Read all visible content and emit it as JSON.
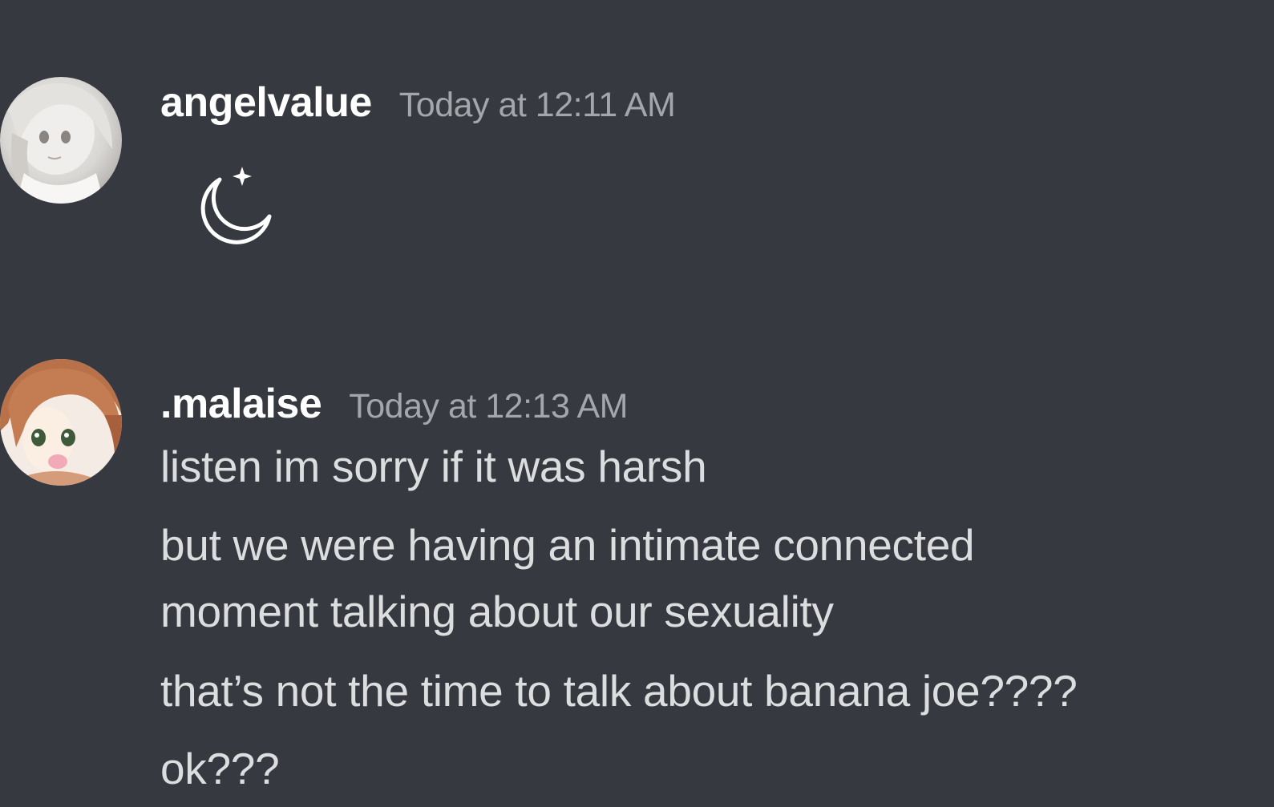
{
  "messages": [
    {
      "author": "angelvalue",
      "timestamp": "Today at 12:11 AM",
      "avatar_icon": "anime-avatar-white-hair",
      "content_icon": "crescent-moon-star-icon",
      "lines": []
    },
    {
      "author": ".malaise",
      "timestamp": "Today at 12:13 AM",
      "avatar_icon": "anime-avatar-brown-hair",
      "lines": [
        "listen im sorry if it was harsh",
        "but we were having an intimate connected",
        "moment talking about our sexuality",
        "that’s not the time to talk about banana joe????",
        "ok???"
      ]
    }
  ],
  "colors": {
    "background": "#36393f",
    "username": "#ffffff",
    "timestamp": "#a3a6aa",
    "message_text": "#dcddde"
  }
}
